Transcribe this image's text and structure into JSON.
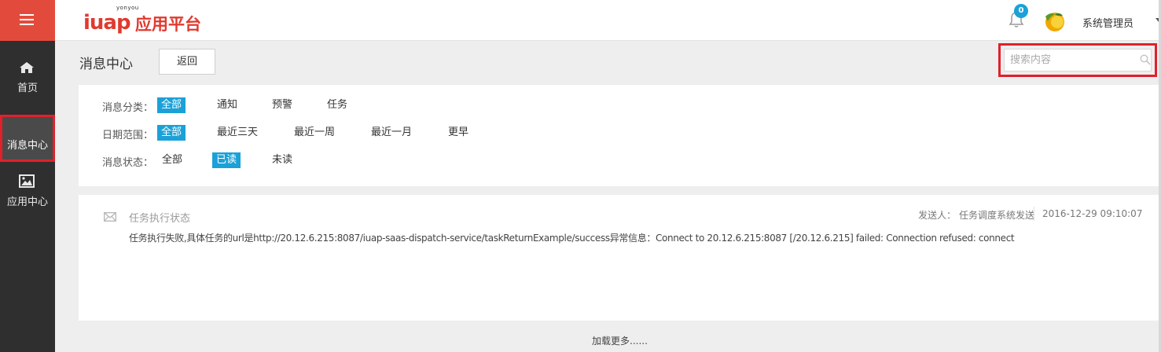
{
  "header": {
    "logo_small": "yonyou",
    "logo_brand": "iuap",
    "logo_cn": "应用平台",
    "notification_count": "0",
    "username": "系统管理员"
  },
  "sidebar": {
    "items": [
      {
        "label": "首页",
        "icon": "home-icon"
      },
      {
        "label": "消息中心",
        "icon": "",
        "active": true
      },
      {
        "label": "应用中心",
        "icon": "image-icon"
      }
    ]
  },
  "page": {
    "title": "消息中心",
    "back_label": "返回",
    "search_placeholder": "搜索内容"
  },
  "filters": {
    "category": {
      "label": "消息分类：",
      "options": [
        "全部",
        "通知",
        "预警",
        "任务"
      ],
      "selected": 0
    },
    "date_range": {
      "label": "日期范围：",
      "options": [
        "全部",
        "最近三天",
        "最近一周",
        "最近一月",
        "更早"
      ],
      "selected": 0
    },
    "status": {
      "label": "消息状态：",
      "options": [
        "全部",
        "已读",
        "未读"
      ],
      "selected": 1
    }
  },
  "messages": [
    {
      "title": "任务执行状态",
      "sender": "发送人： 任务调度系统发送",
      "time": "2016-12-29 09:10:07",
      "body": "任务执行失败,具体任务的url是http://20.12.6.215:8087/iuap-saas-dispatch-service/taskReturnExample/success异常信息：Connect to 20.12.6.215:8087 [/20.12.6.215] failed: Connection refused: connect"
    }
  ],
  "load_more": "加载更多......",
  "colors": {
    "accent": "#1ba1d8",
    "brand_red": "#e03a2f",
    "sidebar_bg": "#2f2f2f",
    "highlight_border": "#e0212b"
  }
}
